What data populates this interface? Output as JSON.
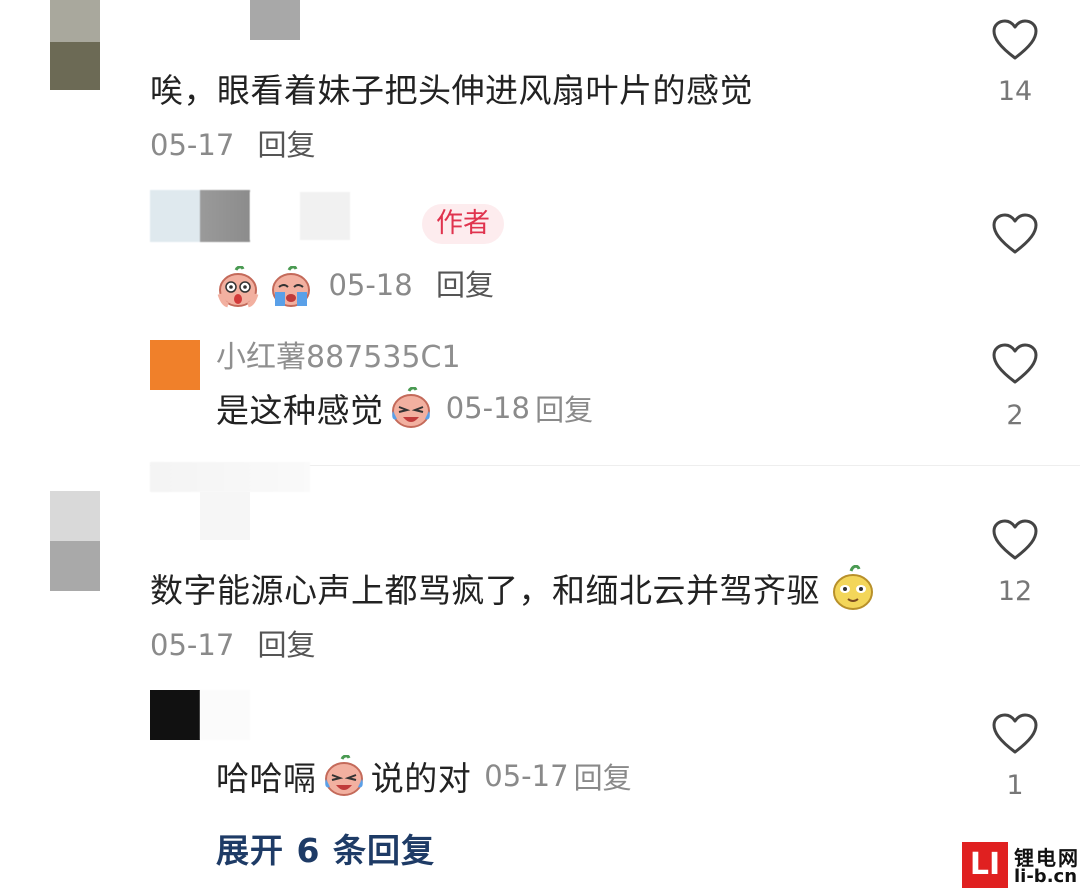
{
  "comments": [
    {
      "text": "唉，眼看着妹子把头伸进风扇叶片的感觉",
      "date": "05-17",
      "reply_label": "回复",
      "likes": "14",
      "replies": [
        {
          "tag": "作者",
          "date": "05-18",
          "reply_label": "回复",
          "likes": ""
        },
        {
          "username": "小红薯887535C1",
          "text": "是这种感觉",
          "date": "05-18",
          "reply_label": "回复",
          "likes": "2"
        }
      ]
    },
    {
      "text": "数字能源心声上都骂疯了，和缅北云并驾齐驱",
      "date": "05-17",
      "reply_label": "回复",
      "likes": "12",
      "replies": [
        {
          "text_before": "哈哈嗝",
          "text_after": "说的对",
          "date": "05-17",
          "reply_label": "回复",
          "likes": "1"
        }
      ],
      "expand_label": "展开 6 条回复"
    }
  ],
  "watermark": {
    "logo": "LI",
    "name": "锂电网",
    "domain": "li-b.cn"
  },
  "colors": {
    "accent_tag": "#e0334e",
    "expand_link": "#1e3b66"
  }
}
